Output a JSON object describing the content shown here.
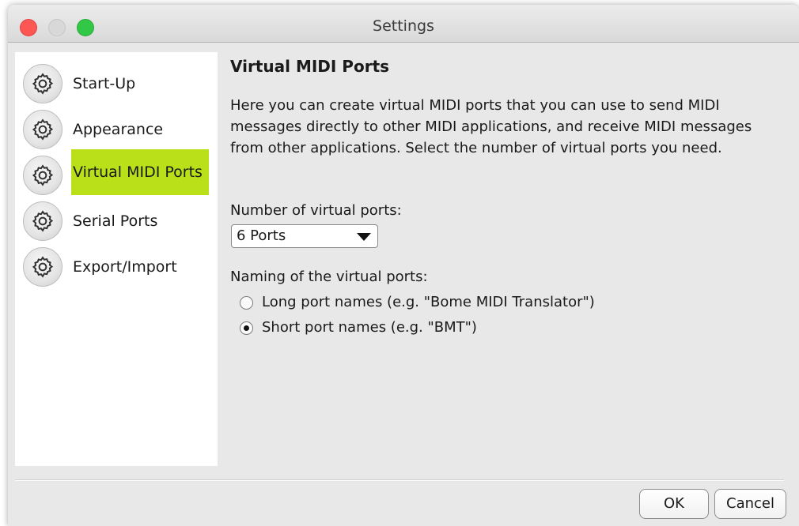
{
  "window": {
    "title": "Settings"
  },
  "sidebar": {
    "selected_color": "#b9e019",
    "items": [
      {
        "label": "Start-Up",
        "icon": "gear-icon"
      },
      {
        "label": "Appearance",
        "icon": "gear-icon"
      },
      {
        "label": "Virtual MIDI Ports",
        "icon": "gear-icon",
        "selected": true
      },
      {
        "label": "Serial Ports",
        "icon": "gear-icon"
      },
      {
        "label": "Export/Import",
        "icon": "gear-icon"
      }
    ]
  },
  "main": {
    "heading": "Virtual MIDI Ports",
    "description": "Here you can create virtual MIDI ports that you can use to send MIDI messages directly to other MIDI applications, and receive MIDI messages from other applications. Select the number of virtual ports you need.",
    "ports_label": "Number of virtual ports:",
    "ports_value": "6 Ports",
    "naming_label": "Naming of the virtual ports:",
    "naming_options": [
      {
        "label": "Long port names (e.g. \"Bome MIDI Translator\")",
        "selected": false
      },
      {
        "label": "Short port names (e.g. \"BMT\")",
        "selected": true
      }
    ]
  },
  "footer": {
    "ok_label": "OK",
    "cancel_label": "Cancel"
  }
}
